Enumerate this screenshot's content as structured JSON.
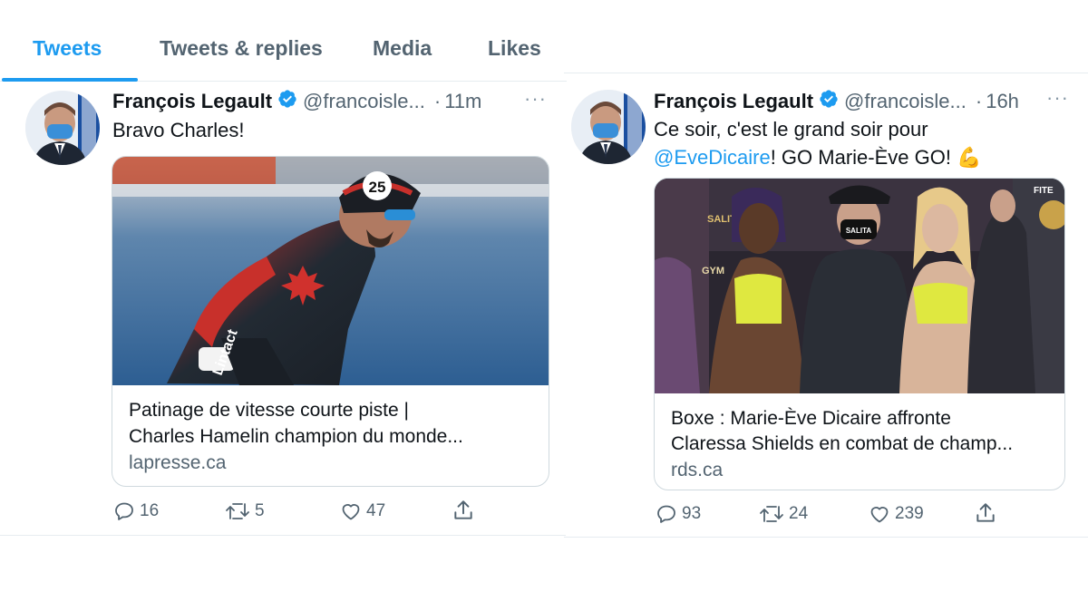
{
  "tabs": {
    "tweets": "Tweets",
    "replies": "Tweets & replies",
    "media": "Media",
    "likes": "Likes"
  },
  "colors": {
    "accent": "#1d9bf0",
    "text_secondary": "#536471",
    "verified": "#1d9bf0"
  },
  "tweet1": {
    "name": "François Legault",
    "handle": "@francoisle...",
    "dot": "·",
    "time": "11m",
    "more": "···",
    "text": "Bravo Charles!",
    "card": {
      "title_line1": "Patinage de vitesse courte piste |",
      "title_line2": "Charles Hamelin champion du monde...",
      "domain": "lapresse.ca",
      "bib_number": "25",
      "suit_text": "Lintact"
    },
    "stats": {
      "replies": "16",
      "retweets": "5",
      "likes": "47"
    }
  },
  "tweet2": {
    "name": "François Legault",
    "handle": "@francoisle...",
    "dot": "·",
    "time": "16h",
    "more": "···",
    "text_line1": "Ce soir, c'est le grand soir pour",
    "mention": "@EveDicaire",
    "text_line2_rest": "! GO Marie-Ève GO! ",
    "emoji": "💪",
    "card": {
      "title_line1": "Boxe : Marie-Ève Dicaire affronte",
      "title_line2": "Claressa Shields en combat de champ...",
      "domain": "rds.ca",
      "banner_left": "SALITA",
      "banner_right": "FITE",
      "banner_gym": "GYM",
      "mask_text": "SALITA"
    },
    "stats": {
      "replies": "93",
      "retweets": "24",
      "likes": "239"
    }
  }
}
